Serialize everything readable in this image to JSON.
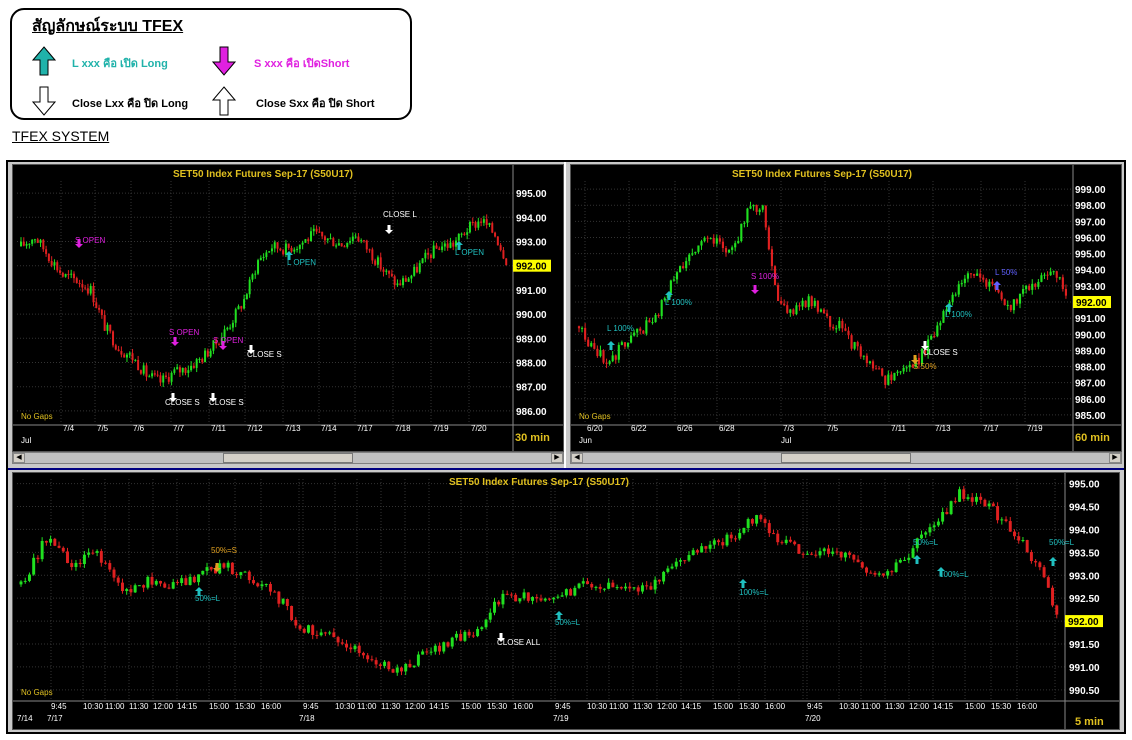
{
  "legend": {
    "title": "สัญลักษณ์ระบบ TFEX",
    "open_long": "L xxx คือ เปิด Long",
    "open_short": "S xxx คือ เปิดShort",
    "close_long": "Close Lxx คือ ปิด Long",
    "close_short": "Close Sxx คือ ปิด Short",
    "colors": {
      "open_long": "#20b2aa",
      "open_short": "#e020e0"
    }
  },
  "system_title": "TFEX SYSTEM",
  "panels": [
    {
      "title": "SET50  Index  Futures  Sep-17   (S50U17)",
      "timeframe": "30  min",
      "last_price": "992.00",
      "no_gaps": "No Gaps",
      "y_ticks": [
        "995.00",
        "994.00",
        "993.00",
        "992.00",
        "991.00",
        "990.00",
        "989.00",
        "988.00",
        "987.00",
        "986.00"
      ],
      "x_ticks": [
        "7/4",
        "7/5",
        "7/6",
        "7/7",
        "7/11",
        "7/12",
        "7/13",
        "7/14",
        "7/17",
        "7/18",
        "7/19",
        "7/20"
      ],
      "x_month": "Jul",
      "annotations": [
        {
          "text": "S  OPEN",
          "kind": "short"
        },
        {
          "text": "S  OPEN",
          "kind": "short"
        },
        {
          "text": "S  OPEN",
          "kind": "short"
        },
        {
          "text": "CLOSE  S",
          "kind": "close"
        },
        {
          "text": "CLOSE  S",
          "kind": "close"
        },
        {
          "text": "CLOSE  S",
          "kind": "close"
        },
        {
          "text": "L  OPEN",
          "kind": "long"
        },
        {
          "text": "CLOSE  L",
          "kind": "close"
        },
        {
          "text": "L  OPEN",
          "kind": "long"
        }
      ]
    },
    {
      "title": "SET50  Index  Futures  Sep-17   (S50U17)",
      "timeframe": "60  min",
      "last_price": "992.00",
      "no_gaps": "No Gaps",
      "y_ticks": [
        "999.00",
        "998.00",
        "997.00",
        "996.00",
        "995.00",
        "994.00",
        "993.00",
        "992.00",
        "991.00",
        "990.00",
        "989.00",
        "988.00",
        "987.00",
        "986.00",
        "985.00"
      ],
      "x_ticks": [
        "6/20",
        "6/22",
        "6/26",
        "6/28",
        "7/3",
        "7/5",
        "7/11",
        "7/13",
        "7/17",
        "7/19"
      ],
      "x_months": [
        "Jun",
        "Jul"
      ],
      "annotations": [
        {
          "text": "L  100%",
          "kind": "long"
        },
        {
          "text": "L  100%",
          "kind": "long"
        },
        {
          "text": "S  100%",
          "kind": "short"
        },
        {
          "text": "CLOSE  S",
          "kind": "close"
        },
        {
          "text": "S  50%",
          "kind": "half"
        },
        {
          "text": "L  100%",
          "kind": "long"
        },
        {
          "text": "L  50%",
          "kind": "longblue"
        }
      ]
    },
    {
      "title": "SET50  Index  Futures  Sep-17   (S50U17)",
      "timeframe": "5  min",
      "last_price": "992.00",
      "no_gaps": "No Gaps",
      "y_ticks": [
        "995.00",
        "994.50",
        "994.00",
        "993.50",
        "993.00",
        "992.50",
        "992.00",
        "991.50",
        "991.00",
        "990.50"
      ],
      "x_ticks": [
        "9:45",
        "10:30",
        "11:00",
        "11:30",
        "12:00",
        "14:15",
        "15:00",
        "15:30",
        "16:00"
      ],
      "x_dates": [
        "7/14",
        "7/17",
        "7/18",
        "7/19",
        "7/20"
      ],
      "annotations": [
        {
          "text": "50%=S",
          "kind": "half"
        },
        {
          "text": "50%=L",
          "kind": "long"
        },
        {
          "text": "CLOSE  ALL",
          "kind": "close"
        },
        {
          "text": "50%=L",
          "kind": "long"
        },
        {
          "text": "100%=L",
          "kind": "long"
        },
        {
          "text": "50%=L",
          "kind": "long"
        },
        {
          "text": "100%=L",
          "kind": "long"
        },
        {
          "text": "50%=L",
          "kind": "long"
        }
      ]
    }
  ],
  "chart_data": [
    {
      "type": "candlestick",
      "title": "SET50  Index  Futures  Sep-17   (S50U17)",
      "interval": "30  min",
      "ylim": [
        985.5,
        995.5
      ],
      "close_path": [
        992.8,
        993.2,
        992.4,
        991.6,
        991.4,
        991.0,
        989.5,
        988.6,
        988.2,
        987.5,
        987.2,
        987.6,
        987.8,
        988.2,
        988.8,
        989.6,
        990.6,
        992.2,
        992.8,
        992.7,
        992.9,
        993.3,
        993.1,
        992.9,
        993.3,
        992.6,
        991.8,
        991.2,
        991.6,
        992.3,
        992.8,
        992.9,
        993.5,
        993.9,
        993.3,
        992.0
      ]
    },
    {
      "type": "candlestick",
      "title": "SET50  Index  Futures  Sep-17   (S50U17)",
      "interval": "60  min",
      "ylim": [
        984.5,
        999.5
      ],
      "close_path": [
        990.5,
        989.0,
        988.3,
        989.5,
        990.2,
        991.0,
        993.0,
        994.8,
        995.8,
        995.6,
        995.2,
        997.5,
        998.0,
        992.0,
        991.4,
        992.2,
        991.0,
        990.5,
        989.2,
        988.0,
        987.2,
        987.8,
        988.2,
        989.6,
        991.7,
        993.4,
        993.6,
        992.8,
        991.5,
        992.6,
        993.2,
        994.0,
        992.0
      ]
    },
    {
      "type": "candlestick",
      "title": "SET50  Index  Futures  Sep-17   (S50U17)",
      "interval": "5  min",
      "ylim": [
        990.3,
        995.1
      ],
      "close_path": [
        992.8,
        993.8,
        993.2,
        993.5,
        992.6,
        992.9,
        992.8,
        993.0,
        993.2,
        993.0,
        992.6,
        991.9,
        991.7,
        991.5,
        991.1,
        990.9,
        991.3,
        991.6,
        991.8,
        992.6,
        992.5,
        992.4,
        992.8,
        992.8,
        992.7,
        992.8,
        993.4,
        993.6,
        993.8,
        994.3,
        993.7,
        993.5,
        993.6,
        993.2,
        993.0,
        993.5,
        994.1,
        994.8,
        994.6,
        994.0,
        993.3,
        992.0
      ]
    }
  ]
}
